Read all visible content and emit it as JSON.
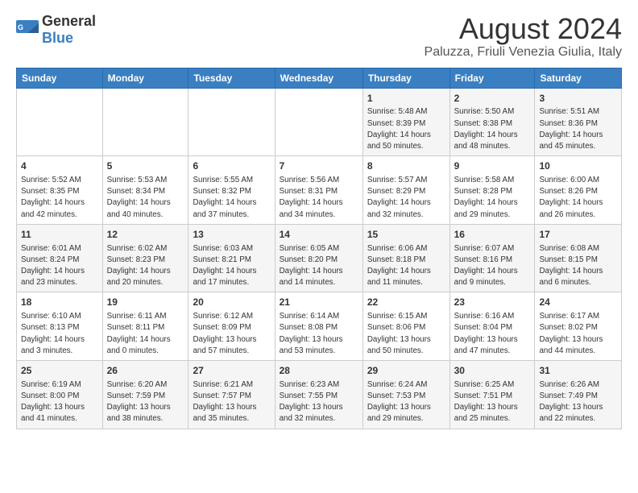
{
  "logo": {
    "general": "General",
    "blue": "Blue"
  },
  "title": "August 2024",
  "subtitle": "Paluzza, Friuli Venezia Giulia, Italy",
  "weekdays": [
    "Sunday",
    "Monday",
    "Tuesday",
    "Wednesday",
    "Thursday",
    "Friday",
    "Saturday"
  ],
  "weeks": [
    [
      {
        "day": "",
        "info": ""
      },
      {
        "day": "",
        "info": ""
      },
      {
        "day": "",
        "info": ""
      },
      {
        "day": "",
        "info": ""
      },
      {
        "day": "1",
        "info": "Sunrise: 5:48 AM\nSunset: 8:39 PM\nDaylight: 14 hours\nand 50 minutes."
      },
      {
        "day": "2",
        "info": "Sunrise: 5:50 AM\nSunset: 8:38 PM\nDaylight: 14 hours\nand 48 minutes."
      },
      {
        "day": "3",
        "info": "Sunrise: 5:51 AM\nSunset: 8:36 PM\nDaylight: 14 hours\nand 45 minutes."
      }
    ],
    [
      {
        "day": "4",
        "info": "Sunrise: 5:52 AM\nSunset: 8:35 PM\nDaylight: 14 hours\nand 42 minutes."
      },
      {
        "day": "5",
        "info": "Sunrise: 5:53 AM\nSunset: 8:34 PM\nDaylight: 14 hours\nand 40 minutes."
      },
      {
        "day": "6",
        "info": "Sunrise: 5:55 AM\nSunset: 8:32 PM\nDaylight: 14 hours\nand 37 minutes."
      },
      {
        "day": "7",
        "info": "Sunrise: 5:56 AM\nSunset: 8:31 PM\nDaylight: 14 hours\nand 34 minutes."
      },
      {
        "day": "8",
        "info": "Sunrise: 5:57 AM\nSunset: 8:29 PM\nDaylight: 14 hours\nand 32 minutes."
      },
      {
        "day": "9",
        "info": "Sunrise: 5:58 AM\nSunset: 8:28 PM\nDaylight: 14 hours\nand 29 minutes."
      },
      {
        "day": "10",
        "info": "Sunrise: 6:00 AM\nSunset: 8:26 PM\nDaylight: 14 hours\nand 26 minutes."
      }
    ],
    [
      {
        "day": "11",
        "info": "Sunrise: 6:01 AM\nSunset: 8:24 PM\nDaylight: 14 hours\nand 23 minutes."
      },
      {
        "day": "12",
        "info": "Sunrise: 6:02 AM\nSunset: 8:23 PM\nDaylight: 14 hours\nand 20 minutes."
      },
      {
        "day": "13",
        "info": "Sunrise: 6:03 AM\nSunset: 8:21 PM\nDaylight: 14 hours\nand 17 minutes."
      },
      {
        "day": "14",
        "info": "Sunrise: 6:05 AM\nSunset: 8:20 PM\nDaylight: 14 hours\nand 14 minutes."
      },
      {
        "day": "15",
        "info": "Sunrise: 6:06 AM\nSunset: 8:18 PM\nDaylight: 14 hours\nand 11 minutes."
      },
      {
        "day": "16",
        "info": "Sunrise: 6:07 AM\nSunset: 8:16 PM\nDaylight: 14 hours\nand 9 minutes."
      },
      {
        "day": "17",
        "info": "Sunrise: 6:08 AM\nSunset: 8:15 PM\nDaylight: 14 hours\nand 6 minutes."
      }
    ],
    [
      {
        "day": "18",
        "info": "Sunrise: 6:10 AM\nSunset: 8:13 PM\nDaylight: 14 hours\nand 3 minutes."
      },
      {
        "day": "19",
        "info": "Sunrise: 6:11 AM\nSunset: 8:11 PM\nDaylight: 14 hours\nand 0 minutes."
      },
      {
        "day": "20",
        "info": "Sunrise: 6:12 AM\nSunset: 8:09 PM\nDaylight: 13 hours\nand 57 minutes."
      },
      {
        "day": "21",
        "info": "Sunrise: 6:14 AM\nSunset: 8:08 PM\nDaylight: 13 hours\nand 53 minutes."
      },
      {
        "day": "22",
        "info": "Sunrise: 6:15 AM\nSunset: 8:06 PM\nDaylight: 13 hours\nand 50 minutes."
      },
      {
        "day": "23",
        "info": "Sunrise: 6:16 AM\nSunset: 8:04 PM\nDaylight: 13 hours\nand 47 minutes."
      },
      {
        "day": "24",
        "info": "Sunrise: 6:17 AM\nSunset: 8:02 PM\nDaylight: 13 hours\nand 44 minutes."
      }
    ],
    [
      {
        "day": "25",
        "info": "Sunrise: 6:19 AM\nSunset: 8:00 PM\nDaylight: 13 hours\nand 41 minutes."
      },
      {
        "day": "26",
        "info": "Sunrise: 6:20 AM\nSunset: 7:59 PM\nDaylight: 13 hours\nand 38 minutes."
      },
      {
        "day": "27",
        "info": "Sunrise: 6:21 AM\nSunset: 7:57 PM\nDaylight: 13 hours\nand 35 minutes."
      },
      {
        "day": "28",
        "info": "Sunrise: 6:23 AM\nSunset: 7:55 PM\nDaylight: 13 hours\nand 32 minutes."
      },
      {
        "day": "29",
        "info": "Sunrise: 6:24 AM\nSunset: 7:53 PM\nDaylight: 13 hours\nand 29 minutes."
      },
      {
        "day": "30",
        "info": "Sunrise: 6:25 AM\nSunset: 7:51 PM\nDaylight: 13 hours\nand 25 minutes."
      },
      {
        "day": "31",
        "info": "Sunrise: 6:26 AM\nSunset: 7:49 PM\nDaylight: 13 hours\nand 22 minutes."
      }
    ]
  ]
}
